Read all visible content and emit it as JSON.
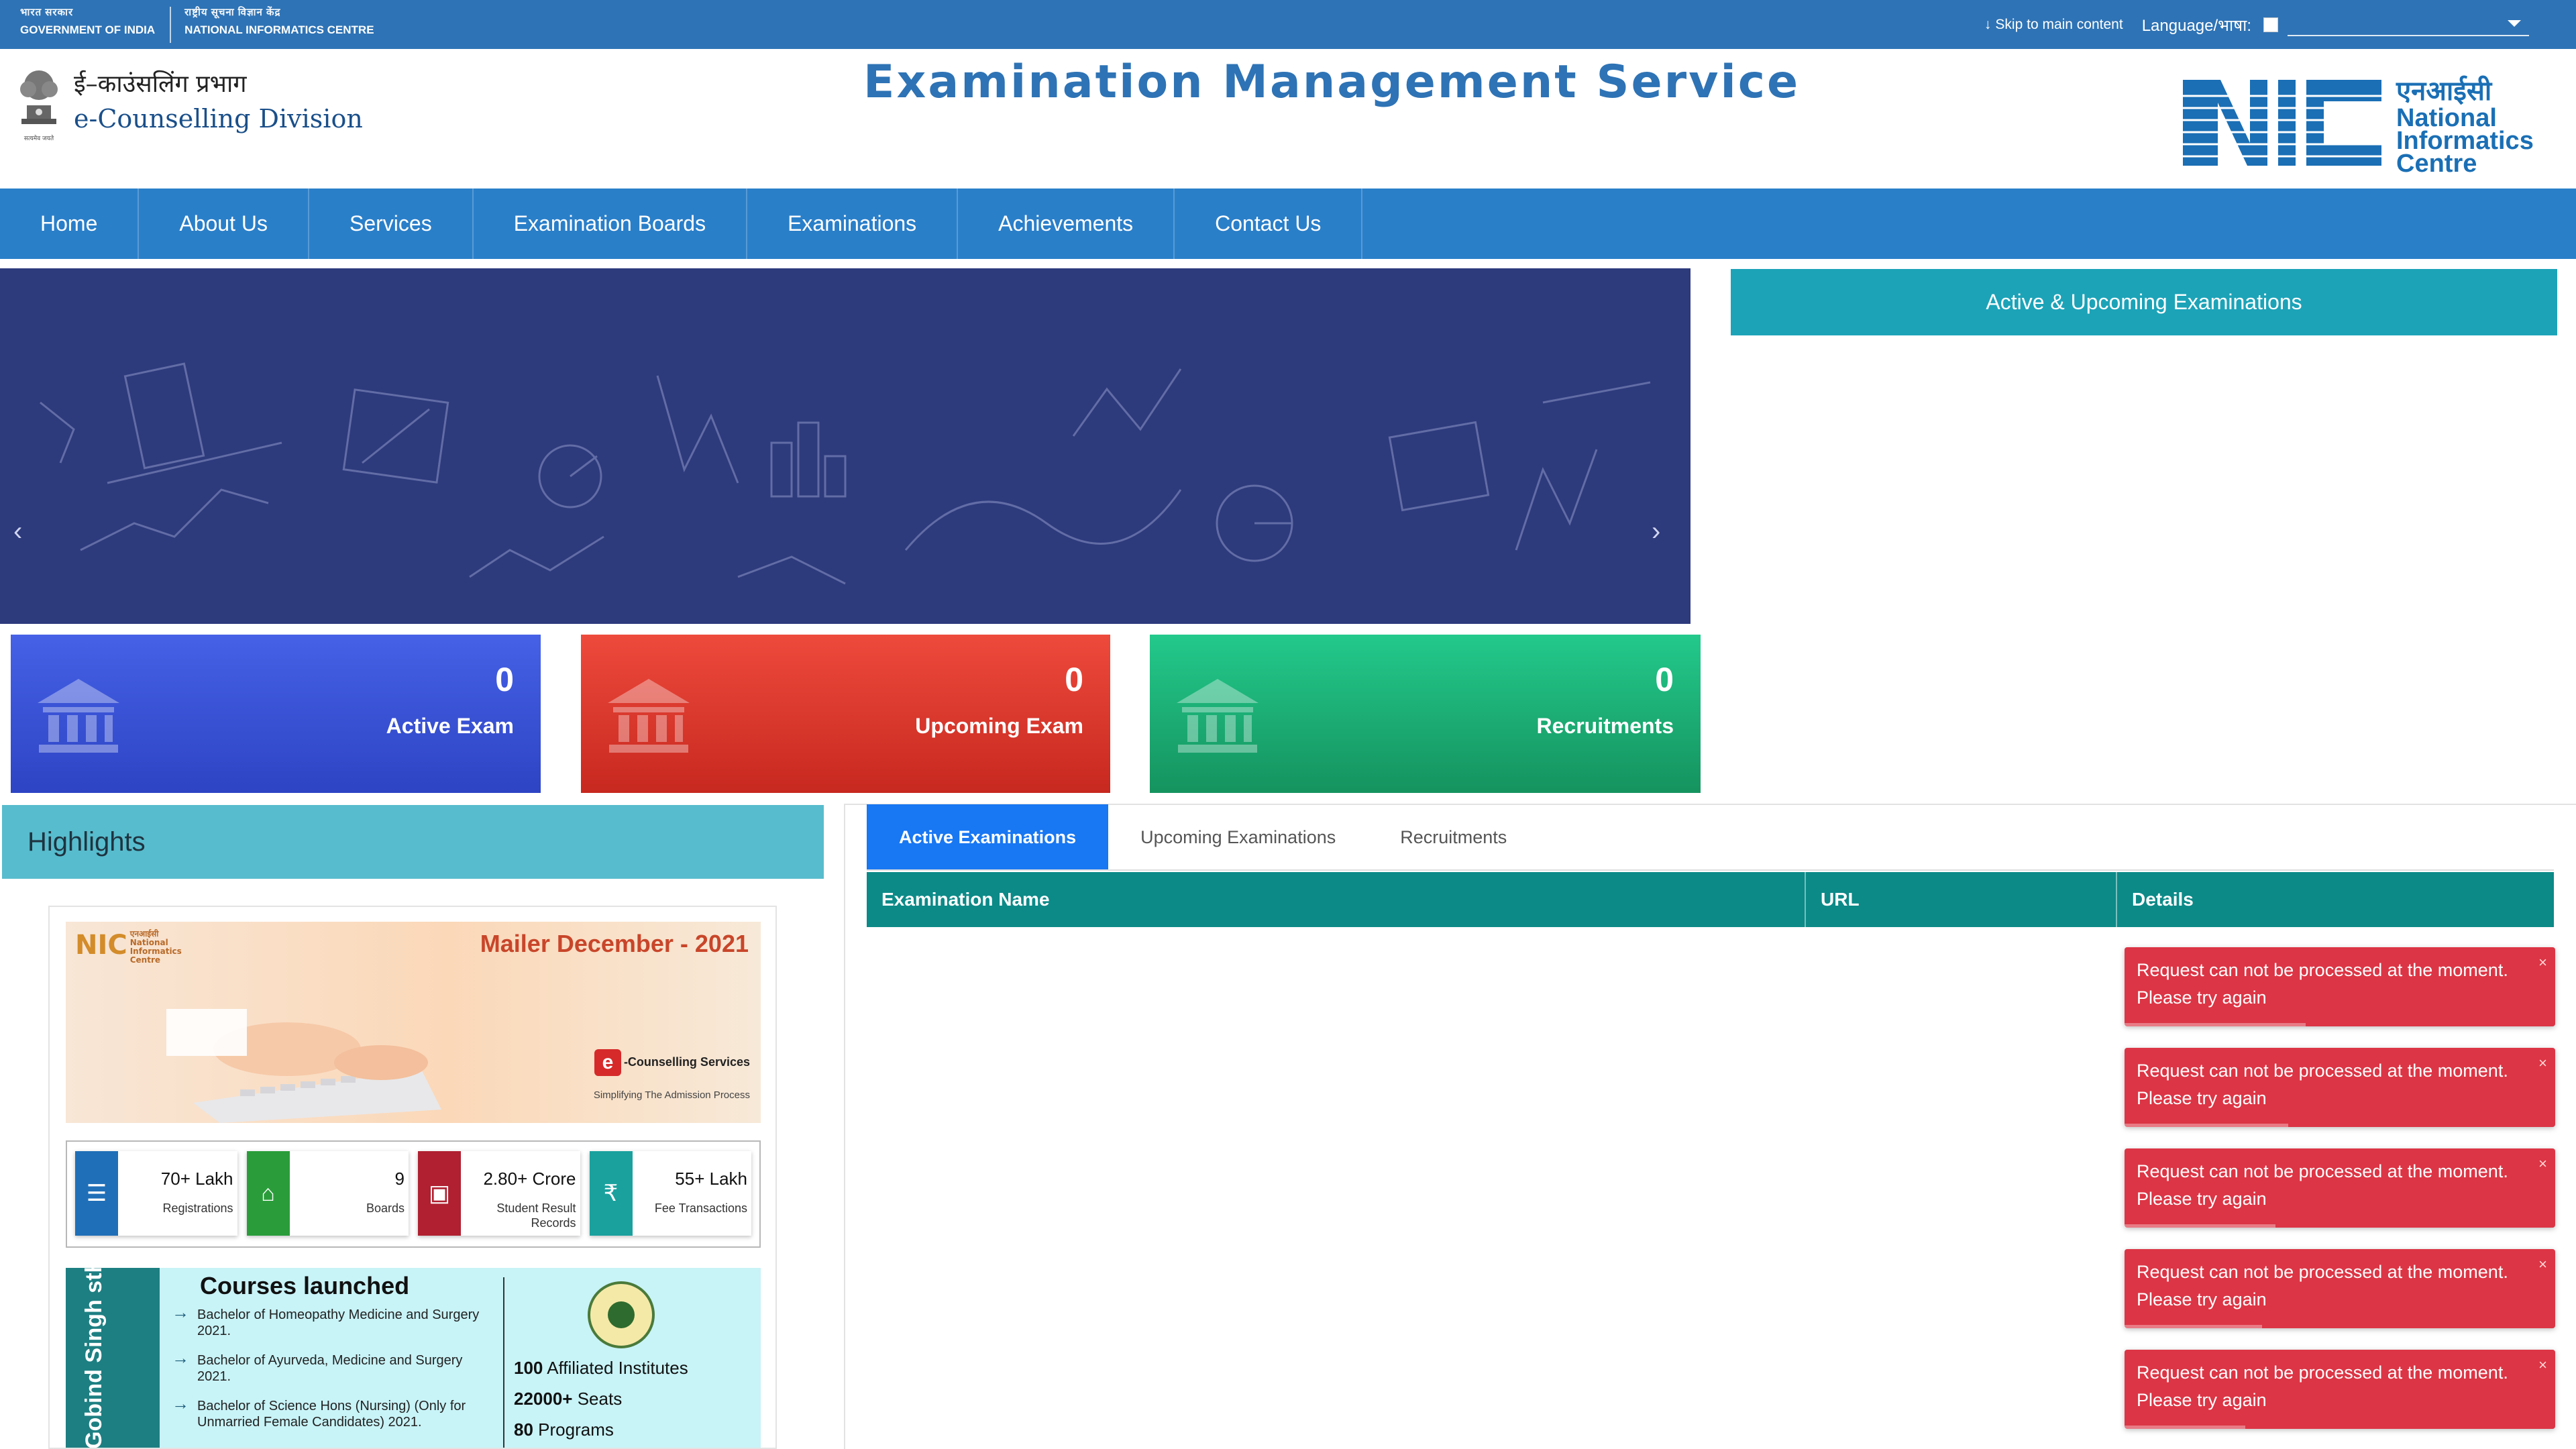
{
  "gov_bar": {
    "gov_hindi": "भारत सरकार",
    "gov_english": "GOVERNMENT OF INDIA",
    "nic_hindi": "राष्ट्रीय सूचना विज्ञान केंद्र",
    "nic_english": "NATIONAL INFORMATICS CENTRE",
    "skip_link": "Skip to main content",
    "language_label": "Language/भाषा:",
    "language_value": ""
  },
  "header": {
    "division_hindi": "ई–काउंसलिंग प्रभाग",
    "division_english": "e-Counselling Division",
    "site_title": "Examination Management Service",
    "nic_hindi": "एनआईसी",
    "nic_line1": "National",
    "nic_line2": "Informatics",
    "nic_line3": "Centre",
    "emblem_motto": "सत्यमेव जयते"
  },
  "nav": {
    "items": [
      "Home",
      "About Us",
      "Services",
      "Examination Boards",
      "Examinations",
      "Achievements",
      "Contact Us"
    ]
  },
  "stats": {
    "active": {
      "value": "0",
      "label": "Active Exam"
    },
    "upcoming": {
      "value": "0",
      "label": "Upcoming Exam"
    },
    "recruitments": {
      "value": "0",
      "label": "Recruitments"
    }
  },
  "active_box": {
    "label": "Active & Upcoming Examinations"
  },
  "highlights": {
    "title": "Highlights",
    "mailer_title": "Mailer December - 2021",
    "mailer_nic": "NIC",
    "mailer_nic_small": "एनआईसी National Informatics Centre",
    "mailer_service": "-Counselling Services",
    "mailer_tagline": "Simplifying The Admission Process",
    "mini_stats": [
      {
        "value": "70+ Lakh",
        "label": "Registrations",
        "color": "#1f6fb8"
      },
      {
        "value": "9",
        "label": "Boards",
        "color": "#2a9d3a"
      },
      {
        "value": "2.80+ Crore",
        "label": "Student Result Records",
        "color": "#b02030"
      },
      {
        "value": "55+ Lakh",
        "label": "Fee Transactions",
        "color": "#1aa19e"
      }
    ],
    "courses_side": "Gobind Singh stha University (GGSIPU)",
    "courses_title": "Courses launched",
    "courses": [
      "Bachelor of Homeopathy Medicine and Surgery 2021.",
      "Bachelor of Ayurveda, Medicine and Surgery 2021.",
      "Bachelor of Science Hons (Nursing) (Only for Unmarried Female Candidates) 2021."
    ],
    "course_stats": [
      {
        "num": "100",
        "text": "Affiliated Institutes"
      },
      {
        "num": "22000+",
        "text": "Seats"
      },
      {
        "num": "80",
        "text": "Programs"
      }
    ]
  },
  "tabs": [
    "Active Examinations",
    "Upcoming Examinations",
    "Recruitments"
  ],
  "table_headers": [
    "Examination Name",
    "URL",
    "Details"
  ],
  "toasts": [
    {
      "line1": "Request can not be processed at the moment.",
      "line2": "Please try again",
      "progress": 0.42
    },
    {
      "line1": "Request can not be processed at the moment.",
      "line2": "Please try again",
      "progress": 0.38
    },
    {
      "line1": "Request can not be processed at the moment.",
      "line2": "Please try again",
      "progress": 0.35
    },
    {
      "line1": "Request can not be processed at the moment.",
      "line2": "Please try again",
      "progress": 0.32
    },
    {
      "line1": "Request can not be processed at the moment.",
      "line2": "Please try again",
      "progress": 0.28
    }
  ]
}
